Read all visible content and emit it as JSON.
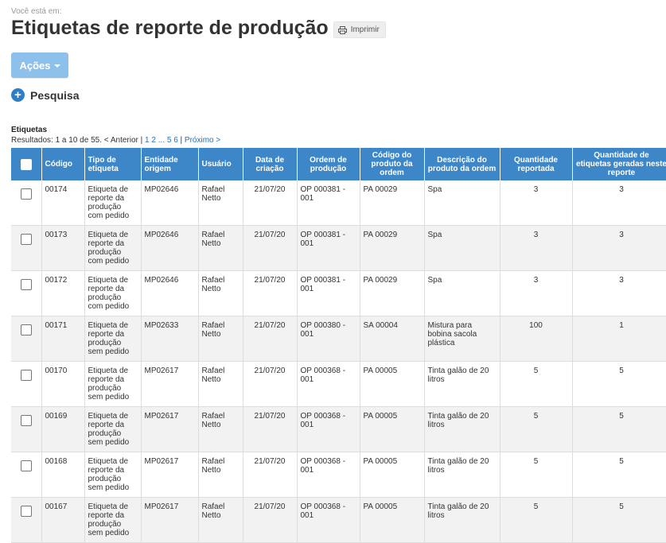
{
  "breadcrumb": "Você está em:",
  "page_title": "Etiquetas de reporte de produção",
  "print_label": "Imprimir",
  "actions_label": "Ações",
  "search_label": "Pesquisa",
  "section_title": "Etiquetas",
  "pagination": {
    "results_text": "Resultados: 1 a 10 de 55.",
    "prev": "< Anterior",
    "sep": "|",
    "page1": "1",
    "page2": "2",
    "ellipsis": "...",
    "page5": "5",
    "page6": "6",
    "next": "Próximo >"
  },
  "columns": [
    "Código",
    "Tipo de etiqueta",
    "Entidade origem",
    "Usuário",
    "Data de criação",
    "Ordem de produção",
    "Código do produto da ordem",
    "Descrição do produto da ordem",
    "Quantidade reportada",
    "Quantidade de etiquetas geradas neste reporte"
  ],
  "rows": [
    {
      "codigo": "00174",
      "tipo": "Etiqueta de reporte da produção com pedido",
      "entidade": "MP02646",
      "usuario": "Rafael Netto",
      "data": "21/07/20",
      "ordem": "OP 000381 - 001",
      "cod_produto": "PA 00029",
      "descricao": "Spa",
      "qtd": "3",
      "qtd_etiquetas": "3"
    },
    {
      "codigo": "00173",
      "tipo": "Etiqueta de reporte da produção com pedido",
      "entidade": "MP02646",
      "usuario": "Rafael Netto",
      "data": "21/07/20",
      "ordem": "OP 000381 - 001",
      "cod_produto": "PA 00029",
      "descricao": "Spa",
      "qtd": "3",
      "qtd_etiquetas": "3"
    },
    {
      "codigo": "00172",
      "tipo": "Etiqueta de reporte da produção com pedido",
      "entidade": "MP02646",
      "usuario": "Rafael Netto",
      "data": "21/07/20",
      "ordem": "OP 000381 - 001",
      "cod_produto": "PA 00029",
      "descricao": "Spa",
      "qtd": "3",
      "qtd_etiquetas": "3"
    },
    {
      "codigo": "00171",
      "tipo": "Etiqueta de reporte da produção sem pedido",
      "entidade": "MP02633",
      "usuario": "Rafael Netto",
      "data": "21/07/20",
      "ordem": "OP 000380 - 001",
      "cod_produto": "SA 00004",
      "descricao": "Mistura para bobina sacola plástica",
      "qtd": "100",
      "qtd_etiquetas": "1"
    },
    {
      "codigo": "00170",
      "tipo": "Etiqueta de reporte da produção sem pedido",
      "entidade": "MP02617",
      "usuario": "Rafael Netto",
      "data": "21/07/20",
      "ordem": "OP 000368 - 001",
      "cod_produto": "PA 00005",
      "descricao": "Tinta galão de 20 litros",
      "qtd": "5",
      "qtd_etiquetas": "5"
    },
    {
      "codigo": "00169",
      "tipo": "Etiqueta de reporte da produção sem pedido",
      "entidade": "MP02617",
      "usuario": "Rafael Netto",
      "data": "21/07/20",
      "ordem": "OP 000368 - 001",
      "cod_produto": "PA 00005",
      "descricao": "Tinta galão de 20 litros",
      "qtd": "5",
      "qtd_etiquetas": "5"
    },
    {
      "codigo": "00168",
      "tipo": "Etiqueta de reporte da produção sem pedido",
      "entidade": "MP02617",
      "usuario": "Rafael Netto",
      "data": "21/07/20",
      "ordem": "OP 000368 - 001",
      "cod_produto": "PA 00005",
      "descricao": "Tinta galão de 20 litros",
      "qtd": "5",
      "qtd_etiquetas": "5"
    },
    {
      "codigo": "00167",
      "tipo": "Etiqueta de reporte da produção sem pedido",
      "entidade": "MP02617",
      "usuario": "Rafael Netto",
      "data": "21/07/20",
      "ordem": "OP 000368 - 001",
      "cod_produto": "PA 00005",
      "descricao": "Tinta galão de 20 litros",
      "qtd": "5",
      "qtd_etiquetas": "5"
    }
  ],
  "icons": {
    "print": "printer-icon",
    "add": "plus-circle-icon",
    "caret": "chevron-down-icon"
  },
  "colors": {
    "header": "#3d87c9",
    "actions": "#8ec0ec",
    "link": "#2a6fb5"
  }
}
